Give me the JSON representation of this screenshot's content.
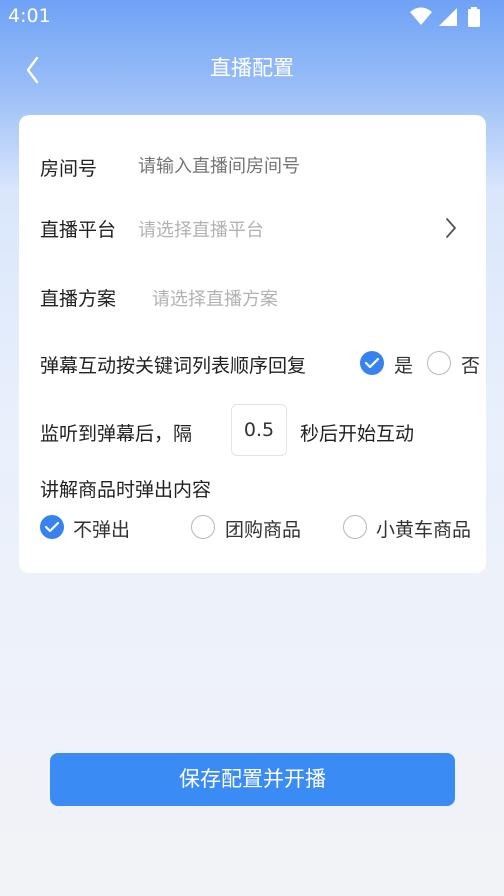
{
  "status_bar": {
    "time": "4:01",
    "icons": [
      "wifi-icon",
      "signal-icon",
      "battery-icon"
    ]
  },
  "nav": {
    "back_icon": "chevron-left-icon",
    "title": "直播配置"
  },
  "form": {
    "room_number": {
      "label": "房间号",
      "placeholder": "请输入直播间房间号"
    },
    "platform": {
      "label": "直播平台",
      "placeholder": "请选择直播平台"
    },
    "plan": {
      "label": "直播方案",
      "placeholder": "请选择直播方案"
    },
    "keyword_order": {
      "label": "弹幕互动按关键词列表顺序回复",
      "yes": "是",
      "no": "否",
      "selected": "是"
    },
    "delay": {
      "prefix": "监听到弹幕后，隔",
      "value": "0.5",
      "suffix": "秒后开始互动"
    },
    "popup": {
      "label": "讲解商品时弹出内容",
      "options": [
        "不弹出",
        "团购商品",
        "小黄车商品"
      ],
      "selected": "不弹出"
    }
  },
  "save_button": {
    "label": "保存配置并开播"
  },
  "colors": {
    "accent": "#3682f1",
    "button": "#3b8bf4",
    "header_top": "#6ea2f6"
  }
}
